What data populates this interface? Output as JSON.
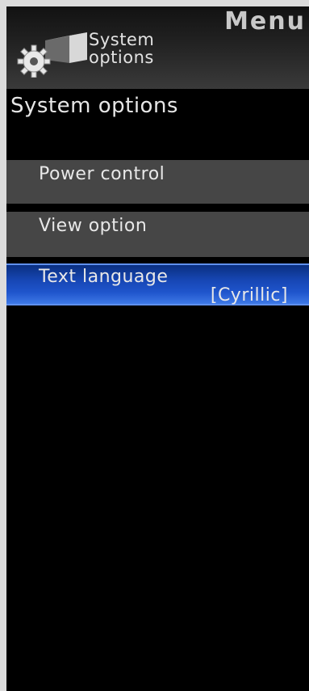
{
  "header": {
    "menu_title": "Menu",
    "icon": "gear-icon",
    "label_line1": "System",
    "label_line2": "options"
  },
  "section_title": "System options",
  "items": [
    {
      "label": "Power control"
    },
    {
      "label": "View option"
    },
    {
      "label": "Text language",
      "value": "[Cyrillic]",
      "selected": true
    }
  ],
  "colors": {
    "selected": "#1f55cc",
    "item_bg": "#464646",
    "background": "#000000"
  }
}
